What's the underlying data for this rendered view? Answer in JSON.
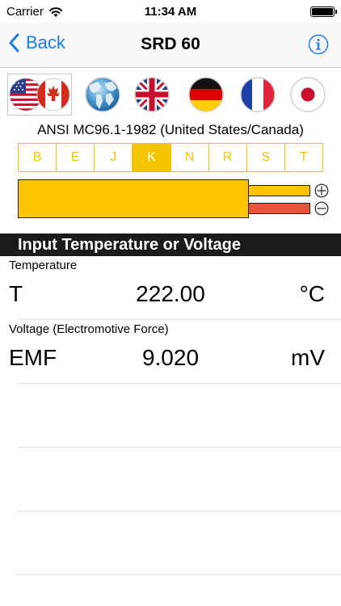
{
  "status": {
    "carrier": "Carrier",
    "time": "11:34 AM"
  },
  "nav": {
    "back_label": "Back",
    "title": "SRD 60"
  },
  "flags": [
    "us-canada",
    "world",
    "uk",
    "germany",
    "france",
    "japan"
  ],
  "standard": "ANSI MC96.1-1982 (United States/Canada)",
  "types": [
    "B",
    "E",
    "J",
    "K",
    "N",
    "R",
    "S",
    "T"
  ],
  "selected_type": "K",
  "section_header": "Input Temperature or Voltage",
  "temperature": {
    "label": "Temperature",
    "symbol": "T",
    "value": "222.00",
    "unit": "°C"
  },
  "voltage": {
    "label": "Voltage (Electromotive Force)",
    "symbol": "EMF",
    "value": "9.020",
    "unit": "mV"
  },
  "colors": {
    "accent": "#1a7cf2",
    "type_yellow": "#f5c400",
    "wire_red": "#e6553a",
    "header_bg": "#1b1b1b"
  }
}
